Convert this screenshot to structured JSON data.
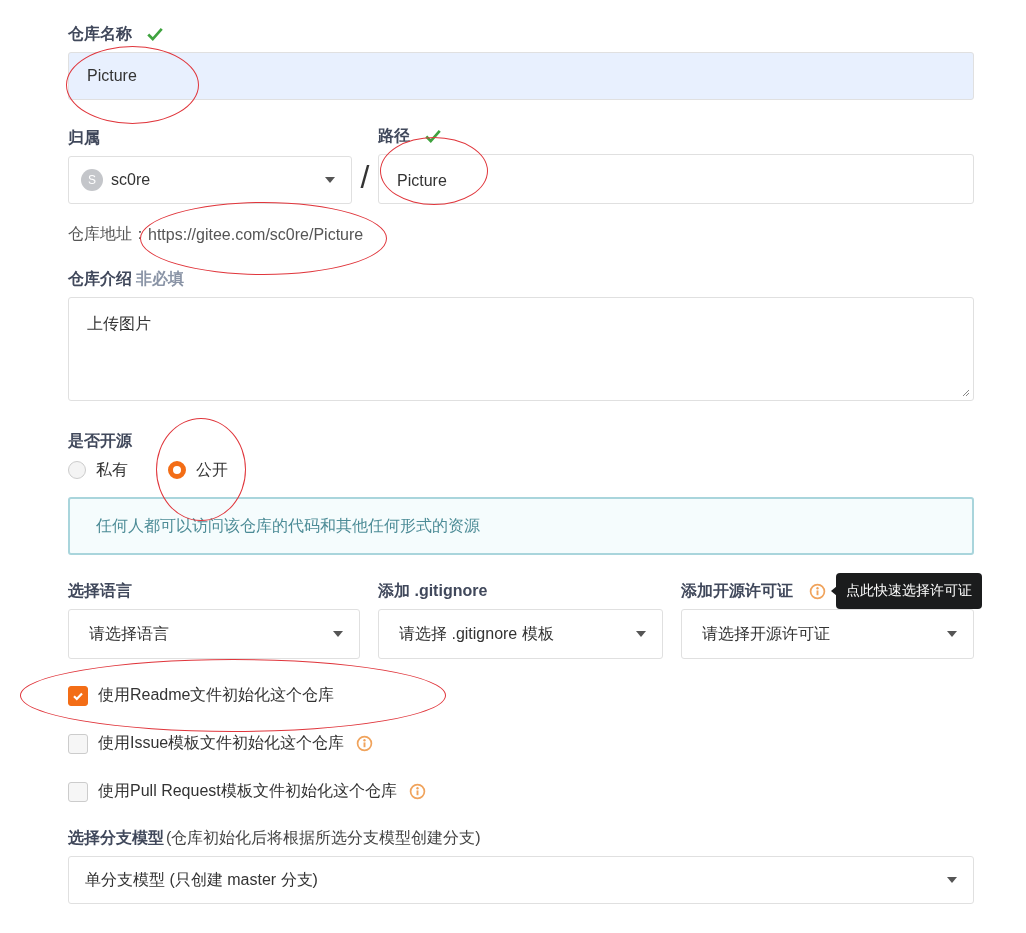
{
  "repo_name": {
    "label": "仓库名称",
    "valid": true,
    "value": "Picture",
    "circled": true
  },
  "owner": {
    "label": "归属",
    "avatar": "S",
    "value": "sc0re"
  },
  "separator": "/",
  "path": {
    "label": "路径",
    "valid": true,
    "value": "Picture",
    "circled": true
  },
  "repo_url": {
    "label": "仓库地址：",
    "value": "https://gitee.com/sc0re/Picture",
    "circled": true
  },
  "description": {
    "label": "仓库介绍",
    "hint": "非必填",
    "value": "上传图片"
  },
  "visibility": {
    "label": "是否开源",
    "options": [
      {
        "label": "私有",
        "selected": false
      },
      {
        "label": "公开",
        "selected": true,
        "circled": true
      }
    ],
    "notice": "任何人都可以访问该仓库的代码和其他任何形式的资源"
  },
  "selects": [
    {
      "label": "选择语言",
      "value": "请选择语言"
    },
    {
      "label": "添加 .gitignore",
      "value": "请选择 .gitignore 模板"
    },
    {
      "label": "添加开源许可证",
      "info": true,
      "tooltip": "点此快速选择许可证",
      "value": "请选择开源许可证"
    }
  ],
  "init_options": [
    {
      "label": "使用Readme文件初始化这个仓库",
      "checked": true,
      "circled": true
    },
    {
      "label": "使用Issue模板文件初始化这个仓库",
      "checked": false,
      "info": true
    },
    {
      "label": "使用Pull Request模板文件初始化这个仓库",
      "checked": false,
      "info": true
    }
  ],
  "branch_model": {
    "label": "选择分支模型",
    "note": "(仓库初始化后将根据所选分支模型创建分支)",
    "value": "单分支模型 (只创建 master 分支)"
  }
}
